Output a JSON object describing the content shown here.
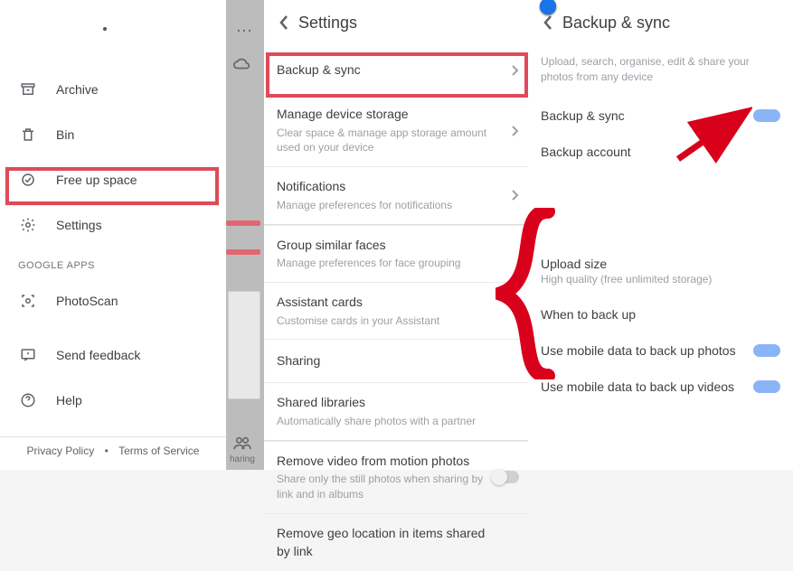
{
  "drawer": {
    "items": [
      {
        "label": "Archive"
      },
      {
        "label": "Bin"
      },
      {
        "label": "Free up space"
      },
      {
        "label": "Settings"
      }
    ],
    "section_label": "GOOGLE APPS",
    "apps": [
      {
        "label": "PhotoScan"
      }
    ],
    "tail": [
      {
        "label": "Send feedback"
      },
      {
        "label": "Help"
      }
    ],
    "footer": {
      "privacy": "Privacy Policy",
      "dot": "•",
      "terms": "Terms of Service"
    }
  },
  "mid": {
    "sharing": "haring"
  },
  "settings": {
    "title": "Settings",
    "items": [
      {
        "title": "Backup & sync",
        "sub": "",
        "chev": true
      },
      {
        "title": "Manage device storage",
        "sub": "Clear space & manage app storage amount used on your device",
        "chev": true
      },
      {
        "title": "Notifications",
        "sub": "Manage preferences for notifications",
        "chev": true
      },
      {
        "title": "Group similar faces",
        "sub": "Manage preferences for face grouping",
        "chev": false
      },
      {
        "title": "Assistant cards",
        "sub": "Customise cards in your Assistant",
        "chev": false
      },
      {
        "title": "Sharing",
        "sub": "",
        "chev": false
      },
      {
        "title": "Shared libraries",
        "sub": "Automatically share photos with a partner",
        "chev": false
      },
      {
        "title": "Remove video from motion photos",
        "sub": "Share only the still photos when sharing by link and in albums",
        "chev": false,
        "toggle": true,
        "toggle_on": false
      },
      {
        "title": "Remove geo location in items shared by link",
        "sub": "",
        "chev": false
      }
    ]
  },
  "backup": {
    "title": "Backup & sync",
    "intro": "Upload, search, organise, edit & share your photos from any device",
    "rows": [
      {
        "title": "Backup & sync",
        "toggle": true,
        "on": true
      },
      {
        "title": "Backup account"
      }
    ],
    "more": [
      {
        "title": "Upload size",
        "sub": "High quality (free unlimited storage)"
      },
      {
        "title": "When to back up"
      },
      {
        "title": "Use mobile data to back up photos",
        "toggle": true,
        "on": true
      },
      {
        "title": "Use mobile data to back up videos",
        "toggle": true,
        "on": true
      }
    ]
  }
}
